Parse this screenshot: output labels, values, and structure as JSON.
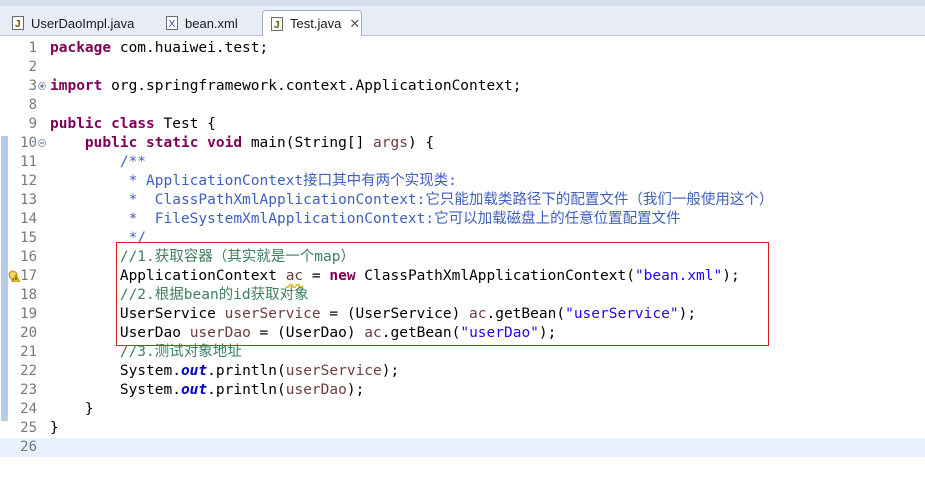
{
  "tabs": [
    {
      "label": "UserDaoImpl.java",
      "icon": "java-file-icon"
    },
    {
      "label": "bean.xml",
      "icon": "xml-file-icon"
    },
    {
      "label": "Test.java",
      "icon": "java-file-icon",
      "close": "✕"
    }
  ],
  "colors": {
    "keyword": "#7f0055",
    "string": "#2a00ff",
    "comment": "#3f7f5f",
    "javadoc": "#3f5fbf",
    "highlight_box": "#e02020"
  },
  "editor": {
    "lines": [
      {
        "n": "1",
        "t": [
          {
            "s": "package",
            "c": "kw"
          },
          {
            "s": " com.huaiwei.test;"
          }
        ]
      },
      {
        "n": "2",
        "t": []
      },
      {
        "n": "3",
        "t": [
          {
            "s": "import",
            "c": "kw"
          },
          {
            "s": " org.springframework.context.ApplicationContext;"
          }
        ]
      },
      {
        "n": "8",
        "t": []
      },
      {
        "n": "9",
        "t": [
          {
            "s": "public",
            "c": "kw"
          },
          {
            "s": " "
          },
          {
            "s": "class",
            "c": "kw"
          },
          {
            "s": " Test {"
          }
        ]
      },
      {
        "n": "10",
        "t": [
          {
            "s": "    "
          },
          {
            "s": "public",
            "c": "kw"
          },
          {
            "s": " "
          },
          {
            "s": "static",
            "c": "kw"
          },
          {
            "s": " "
          },
          {
            "s": "void",
            "c": "kw"
          },
          {
            "s": " main(String[] "
          },
          {
            "s": "args",
            "c": "var"
          },
          {
            "s": ") {"
          }
        ]
      },
      {
        "n": "11",
        "t": [
          {
            "s": "        /**",
            "c": "jd"
          }
        ]
      },
      {
        "n": "12",
        "t": [
          {
            "s": "         * ApplicationContext接口其中有两个实现类:",
            "c": "jd"
          }
        ]
      },
      {
        "n": "13",
        "t": [
          {
            "s": "         *  ClassPathXmlApplicationContext:它只能加载类路径下的配置文件（我们一般使用这个）",
            "c": "jd"
          }
        ]
      },
      {
        "n": "14",
        "t": [
          {
            "s": "         *  FileSystemXmlApplicationContext:它可以加载磁盘上的任意位置配置文件",
            "c": "jd"
          }
        ]
      },
      {
        "n": "15",
        "t": [
          {
            "s": "         */",
            "c": "jd"
          }
        ]
      },
      {
        "n": "16",
        "t": [
          {
            "s": "        //1.获取容器（其实就是一个map）",
            "c": "cm"
          }
        ]
      },
      {
        "n": "17",
        "t": [
          {
            "s": "        ApplicationContext "
          },
          {
            "s": "ac",
            "c": "var warnvar"
          },
          {
            "s": " = "
          },
          {
            "s": "new",
            "c": "kw"
          },
          {
            "s": " ClassPathXmlApplicationContext("
          },
          {
            "s": "\"bean.xml\"",
            "c": "str"
          },
          {
            "s": ");"
          }
        ]
      },
      {
        "n": "18",
        "t": [
          {
            "s": "        //2.根据bean的id获取对象",
            "c": "cm"
          }
        ]
      },
      {
        "n": "19",
        "t": [
          {
            "s": "        UserService "
          },
          {
            "s": "userService",
            "c": "var"
          },
          {
            "s": " = (UserService) "
          },
          {
            "s": "ac",
            "c": "var"
          },
          {
            "s": ".getBean("
          },
          {
            "s": "\"userService\"",
            "c": "str"
          },
          {
            "s": ");"
          }
        ]
      },
      {
        "n": "20",
        "t": [
          {
            "s": "        UserDao "
          },
          {
            "s": "userDao",
            "c": "var"
          },
          {
            "s": " = (UserDao) "
          },
          {
            "s": "ac",
            "c": "var"
          },
          {
            "s": ".getBean("
          },
          {
            "s": "\"userDao\"",
            "c": "str"
          },
          {
            "s": ");"
          }
        ]
      },
      {
        "n": "21",
        "t": [
          {
            "s": "        //3.测试对象地址",
            "c": "cm"
          }
        ]
      },
      {
        "n": "22",
        "t": [
          {
            "s": "        System."
          },
          {
            "s": "out",
            "c": "fld"
          },
          {
            "s": ".println("
          },
          {
            "s": "userService",
            "c": "var"
          },
          {
            "s": ");"
          }
        ]
      },
      {
        "n": "23",
        "t": [
          {
            "s": "        System."
          },
          {
            "s": "out",
            "c": "fld"
          },
          {
            "s": ".println("
          },
          {
            "s": "userDao",
            "c": "var"
          },
          {
            "s": ");"
          }
        ]
      },
      {
        "n": "24",
        "t": [
          {
            "s": "    }"
          }
        ]
      },
      {
        "n": "25",
        "t": [
          {
            "s": "}"
          }
        ]
      },
      {
        "n": "26",
        "t": [],
        "current": true
      }
    ]
  }
}
